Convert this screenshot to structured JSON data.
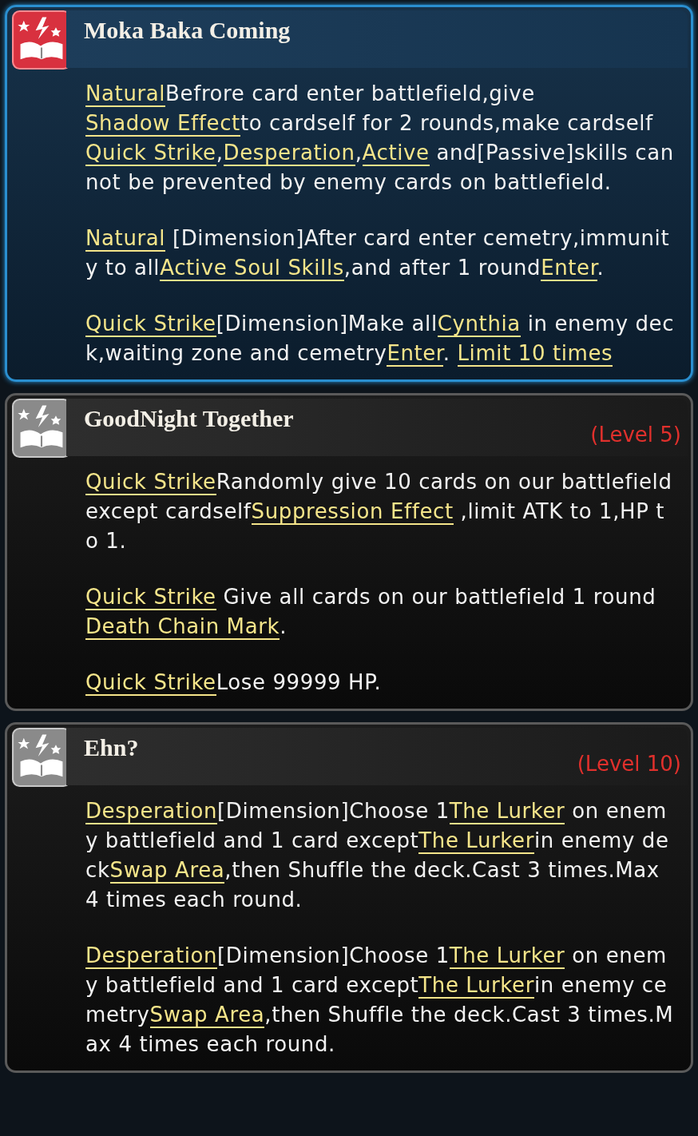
{
  "skills": [
    {
      "title": "Moka Baka Coming",
      "active": true,
      "paragraphs": [
        [
          {
            "kind": "link",
            "text": "Natural"
          },
          {
            "kind": "plain",
            "text": "Befrore card enter battlefield,give"
          },
          {
            "kind": "link",
            "text": "Shadow Effect"
          },
          {
            "kind": "plain",
            "text": "to cardself for 2 rounds,make cardself"
          },
          {
            "kind": "link",
            "text": "Quick Strike"
          },
          {
            "kind": "plain",
            "text": ","
          },
          {
            "kind": "link",
            "text": "Desperation"
          },
          {
            "kind": "plain",
            "text": ","
          },
          {
            "kind": "link",
            "text": "Active"
          },
          {
            "kind": "plain",
            "text": " and[Passive]skills can not be prevented by enemy cards on battlefield."
          }
        ],
        [
          {
            "kind": "link",
            "text": "Natural"
          },
          {
            "kind": "plain",
            "text": " [Dimension]After card enter cemetry,immunity to all"
          },
          {
            "kind": "link",
            "text": "Active Soul Skills"
          },
          {
            "kind": "plain",
            "text": ",and after 1 round"
          },
          {
            "kind": "link",
            "text": "Enter"
          },
          {
            "kind": "plain",
            "text": "."
          }
        ],
        [
          {
            "kind": "link",
            "text": "Quick Strike"
          },
          {
            "kind": "plain",
            "text": "[Dimension]Make all"
          },
          {
            "kind": "link",
            "text": "Cynthia"
          },
          {
            "kind": "plain",
            "text": " in enemy deck,waiting zone and cemetry"
          },
          {
            "kind": "link",
            "text": "Enter"
          },
          {
            "kind": "plain",
            "text": ". "
          },
          {
            "kind": "link",
            "text": "Limit 10 times"
          }
        ]
      ]
    },
    {
      "title": "GoodNight Together",
      "level": "(Level 5)",
      "active": false,
      "paragraphs": [
        [
          {
            "kind": "link",
            "text": "Quick Strike"
          },
          {
            "kind": "plain",
            "text": "Randomly give 10 cards on our battlefield except cardself"
          },
          {
            "kind": "link",
            "text": "Suppression Effect"
          },
          {
            "kind": "plain",
            "text": " ,limit ATK to 1,HP to 1."
          }
        ],
        [
          {
            "kind": "link",
            "text": "Quick Strike"
          },
          {
            "kind": "plain",
            "text": " Give all cards on our battlefield 1 round"
          },
          {
            "kind": "link",
            "text": "Death Chain Mark"
          },
          {
            "kind": "plain",
            "text": "."
          }
        ],
        [
          {
            "kind": "link",
            "text": "Quick Strike"
          },
          {
            "kind": "plain",
            "text": "Lose 99999 HP."
          }
        ]
      ]
    },
    {
      "title": "Ehn?",
      "level": "(Level 10)",
      "active": false,
      "paragraphs": [
        [
          {
            "kind": "link",
            "text": "Desperation"
          },
          {
            "kind": "plain",
            "text": "[Dimension]Choose 1"
          },
          {
            "kind": "link",
            "text": "The Lurker"
          },
          {
            "kind": "plain",
            "text": " on enemy battlefield and 1 card except"
          },
          {
            "kind": "link",
            "text": "The Lurker"
          },
          {
            "kind": "plain",
            "text": "in enemy deck"
          },
          {
            "kind": "link",
            "text": "Swap Area"
          },
          {
            "kind": "plain",
            "text": ",then Shuffle the deck.Cast 3 times.Max 4 times each round."
          }
        ],
        [
          {
            "kind": "link",
            "text": "Desperation"
          },
          {
            "kind": "plain",
            "text": "[Dimension]Choose 1"
          },
          {
            "kind": "link",
            "text": "The Lurker"
          },
          {
            "kind": "plain",
            "text": " on enemy battlefield and 1 card except"
          },
          {
            "kind": "link",
            "text": "The Lurker"
          },
          {
            "kind": "plain",
            "text": "in enemy cemetry"
          },
          {
            "kind": "link",
            "text": "Swap Area"
          },
          {
            "kind": "plain",
            "text": ",then Shuffle the deck.Cast 3 times.Max 4 times each round."
          }
        ]
      ]
    }
  ]
}
